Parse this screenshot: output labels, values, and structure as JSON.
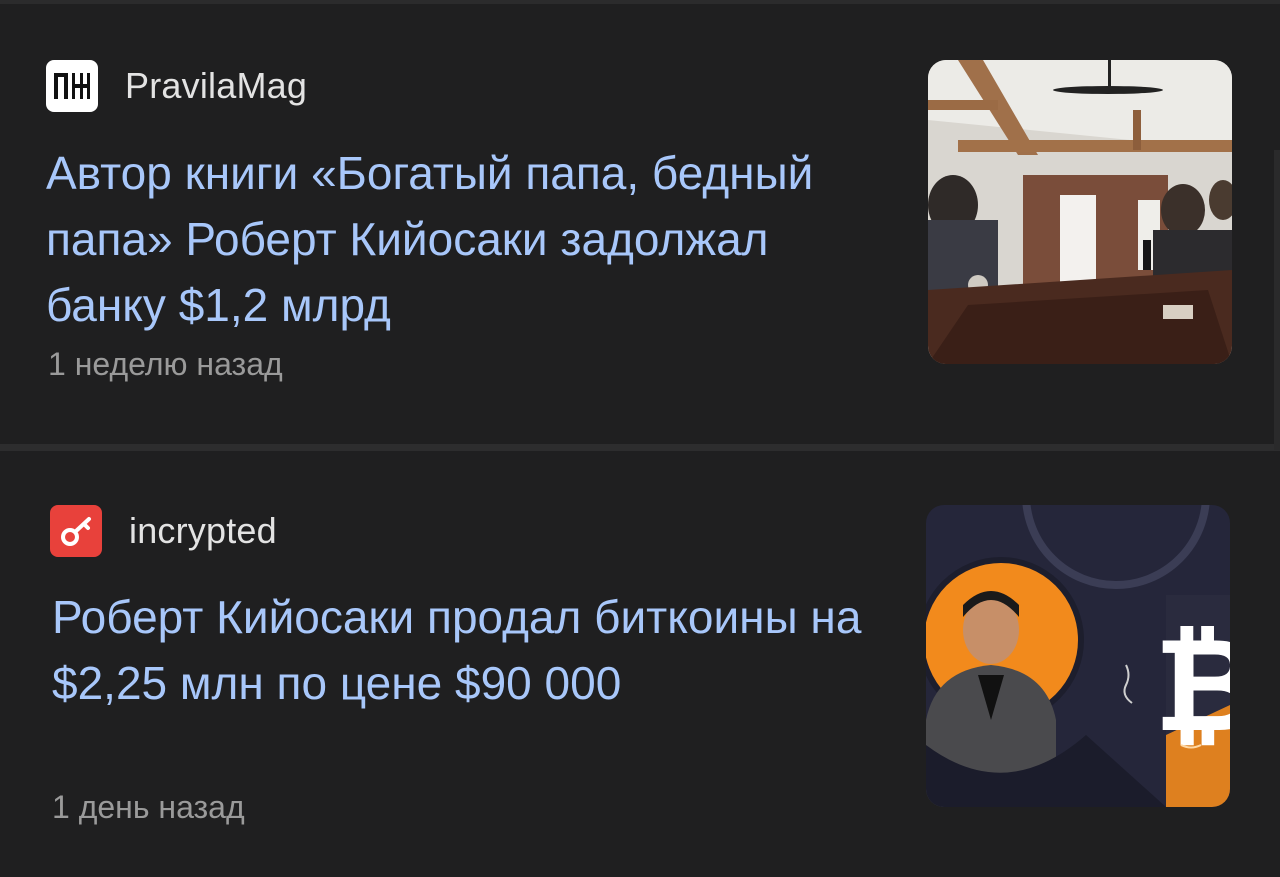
{
  "feed": {
    "items": [
      {
        "source": "PravilaMag",
        "source_icon": "pravilamag-logo-icon",
        "headline": "Автор книги «Богатый папа, бедный папа» Роберт Кийосаки задолжал банку $1,2 млрд",
        "time": "1 неделю назад",
        "thumbnail": "meeting-room-photo"
      },
      {
        "source": "incrypted",
        "source_icon": "incrypted-logo-icon",
        "headline": "Роберт Кийосаки продал биткоины на $2,25 млн по цене $90 000",
        "time": "1 день назад",
        "thumbnail": "kiyosaki-bitcoin-image"
      }
    ]
  },
  "colors": {
    "background": "#1f1f20",
    "headline": "#a8c7fa",
    "source": "#e3e3e3",
    "time": "#9a9a9a",
    "incrypted_brand": "#e8413b",
    "bitcoin_orange": "#f28a1c"
  }
}
